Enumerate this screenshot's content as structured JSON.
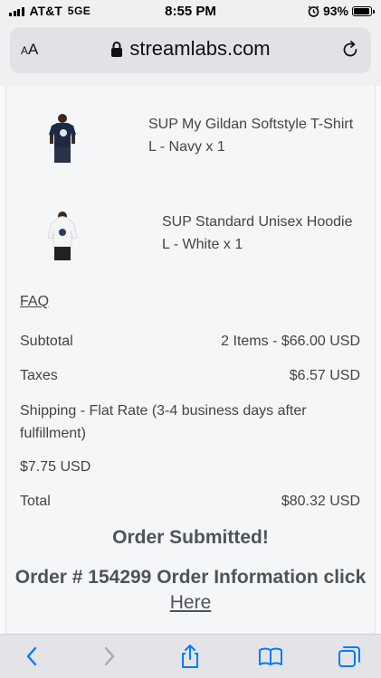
{
  "status_bar": {
    "carrier": "AT&T",
    "network": "5GE",
    "time": "8:55 PM",
    "battery": "93%",
    "battery_level": 0.93
  },
  "browser": {
    "text_size_label": "AA",
    "url": "streamlabs.com"
  },
  "order": {
    "items": [
      {
        "name": "SUP My Gildan Softstyle T-Shirt",
        "variant": "L - Navy x 1",
        "color": "#1e2a44"
      },
      {
        "name": "SUP Standard Unisex Hoodie",
        "variant": "L - White x 1",
        "color": "#f4f4f4"
      }
    ],
    "faq_label": "FAQ",
    "subtotal_label": "Subtotal",
    "subtotal_value": "2 Items - $66.00 USD",
    "taxes_label": "Taxes",
    "taxes_value": "$6.57 USD",
    "shipping_label": "Shipping - Flat Rate (3-4 business days after fulfillment)",
    "shipping_value": "$7.75 USD",
    "total_label": "Total",
    "total_value": "$80.32 USD",
    "submitted_text": "Order Submitted!",
    "order_info_text": "Order # 154299 Order Information click",
    "here_link": "Here"
  },
  "icons": {
    "back": "chevron-left-icon",
    "forward": "chevron-right-icon",
    "share": "share-icon",
    "bookmarks": "book-icon",
    "tabs": "tabs-icon"
  },
  "colors": {
    "accent": "#007aff",
    "heading": "#4d545a",
    "text": "#444444"
  }
}
